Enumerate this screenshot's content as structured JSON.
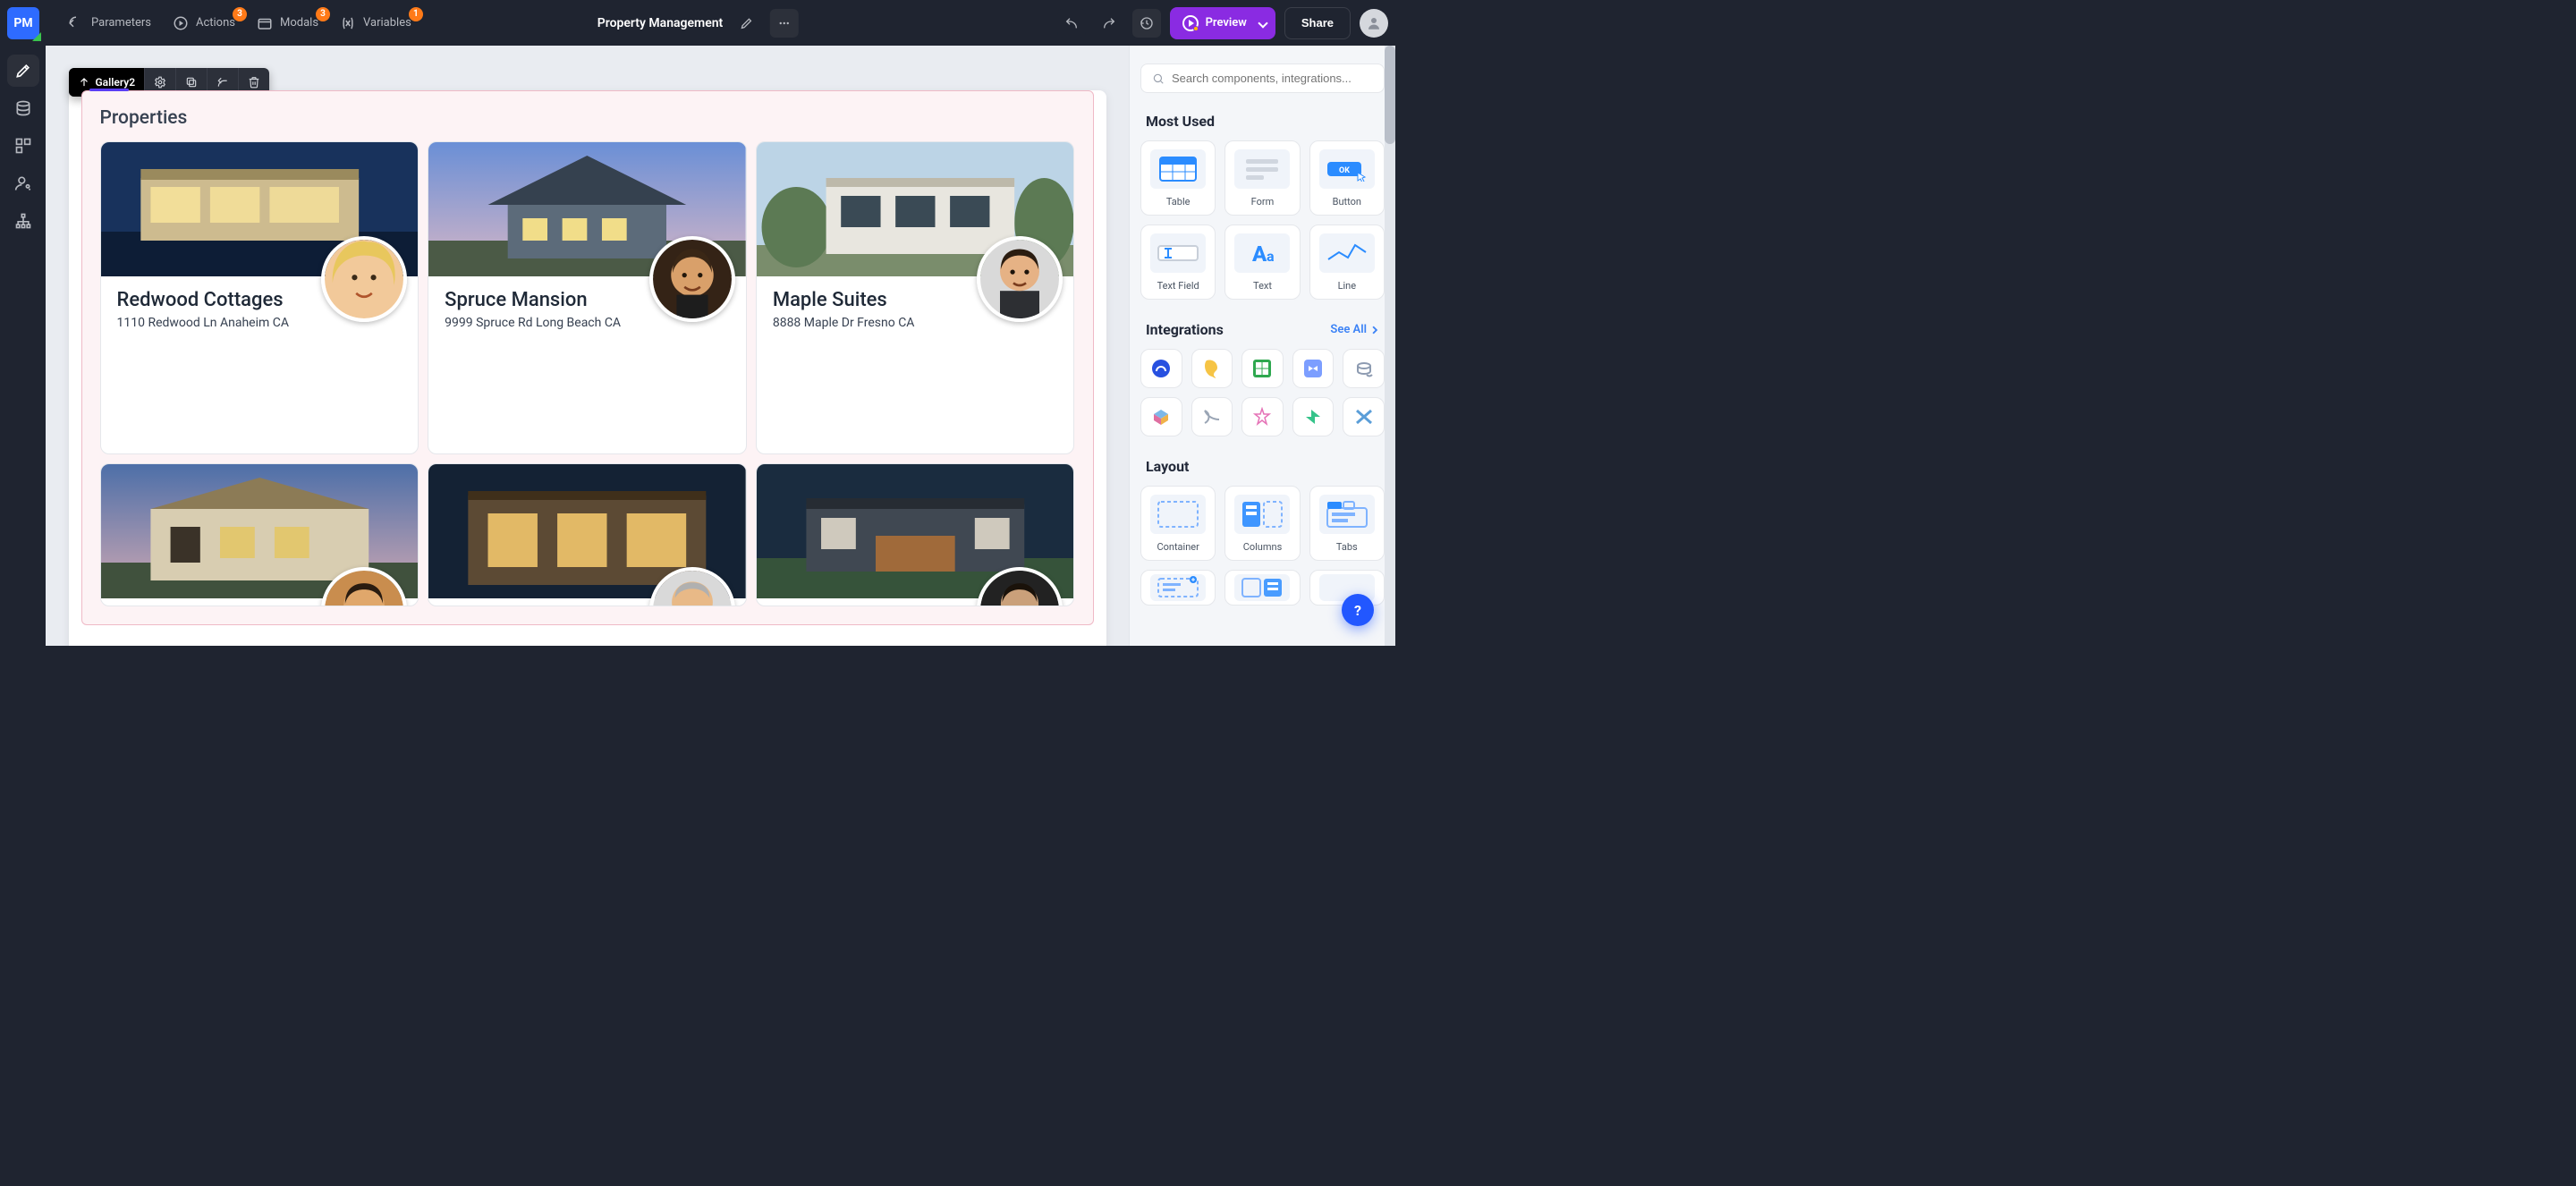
{
  "topbar": {
    "logo_text": "PM",
    "parameters_label": "Parameters",
    "actions_label": "Actions",
    "actions_badge": "3",
    "modals_label": "Modals",
    "modals_badge": "3",
    "variables_label": "Variables",
    "variables_badge": "1",
    "page_title": "Property Management",
    "preview_label": "Preview",
    "share_label": "Share"
  },
  "selection": {
    "component_name": "Gallery2"
  },
  "gallery": {
    "title": "Properties",
    "cards": [
      {
        "name": "Redwood Cottages",
        "address": "1110 Redwood Ln Anaheim CA"
      },
      {
        "name": "Spruce Mansion",
        "address": "9999 Spruce Rd Long Beach CA"
      },
      {
        "name": "Maple Suites",
        "address": "8888 Maple Dr Fresno CA"
      }
    ]
  },
  "rightpanel": {
    "search_placeholder": "Search components, integrations...",
    "most_used_heading": "Most Used",
    "integrations_heading": "Integrations",
    "see_all_label": "See All",
    "layout_heading": "Layout",
    "components": {
      "table": "Table",
      "form": "Form",
      "button": "Button",
      "textfield": "Text Field",
      "text": "Text",
      "line": "Line",
      "container": "Container",
      "columns": "Columns",
      "tabs": "Tabs"
    },
    "button_icon_text": "OK"
  },
  "help_label": "?",
  "colors": {
    "brand_purple": "#8a2be2",
    "brand_blue": "#2e6bff",
    "badge_orange": "#ff7a18"
  }
}
